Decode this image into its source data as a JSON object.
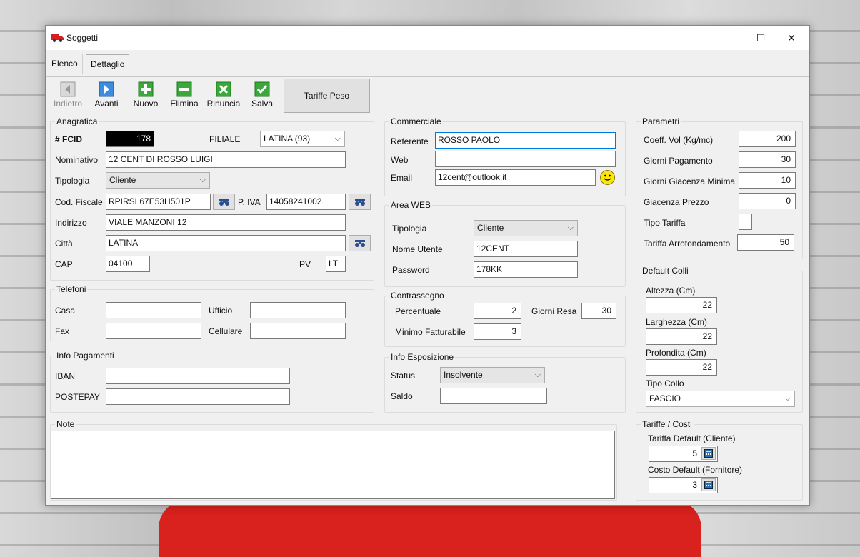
{
  "window": {
    "title": "Soggetti",
    "minimize": "—",
    "maximize": "☐",
    "close": "✕"
  },
  "tabs": [
    {
      "label": "Elenco",
      "active": false
    },
    {
      "label": "Dettaglio",
      "active": true
    }
  ],
  "toolbar": {
    "indietro": "Indietro",
    "avanti": "Avanti",
    "nuovo": "Nuovo",
    "elimina": "Elimina",
    "rinuncia": "Rinuncia",
    "salva": "Salva",
    "tariffe_peso": "Tariffe Peso"
  },
  "anagrafica": {
    "title": "Anagrafica",
    "fcid_label": "# FCID",
    "fcid_value": "178",
    "filiale_label": "FILIALE",
    "filiale_value": "LATINA (93)",
    "nominativo_label": "Nominativo",
    "nominativo_value": "12 CENT DI ROSSO LUIGI",
    "tipologia_label": "Tipologia",
    "tipologia_value": "Cliente",
    "codfiscale_label": "Cod. Fiscale",
    "codfiscale_value": "RPIRSL67E53H501P",
    "piva_label": "P. IVA",
    "piva_value": "14058241002",
    "indirizzo_label": "Indirizzo",
    "indirizzo_value": "VIALE MANZONI 12",
    "citta_label": "Città",
    "citta_value": "LATINA",
    "cap_label": "CAP",
    "cap_value": "04100",
    "pv_label": "PV",
    "pv_value": "LT"
  },
  "telefoni": {
    "title": "Telefoni",
    "casa_label": "Casa",
    "casa_value": "",
    "ufficio_label": "Ufficio",
    "ufficio_value": "",
    "fax_label": "Fax",
    "fax_value": "",
    "cellulare_label": "Cellulare",
    "cellulare_value": ""
  },
  "info_pagamenti": {
    "title": "Info Pagamenti",
    "iban_label": "IBAN",
    "iban_value": "",
    "postepay_label": "POSTEPAY",
    "postepay_value": ""
  },
  "note": {
    "title": "Note",
    "value": ""
  },
  "commerciale": {
    "title": "Commerciale",
    "referente_label": "Referente",
    "referente_value": "ROSSO PAOLO",
    "web_label": "Web",
    "web_value": "",
    "email_label": "Email",
    "email_value": "12cent@outlook.it"
  },
  "area_web": {
    "title": "Area WEB",
    "tipologia_label": "Tipologia",
    "tipologia_value": "Cliente",
    "nome_utente_label": "Nome Utente",
    "nome_utente_value": "12CENT",
    "password_label": "Password",
    "password_value": "178KK"
  },
  "contrassegno": {
    "title": "Contrassegno",
    "percentuale_label": "Percentuale",
    "percentuale_value": "2",
    "giorni_resa_label": "Giorni Resa",
    "giorni_resa_value": "30",
    "minimo_label": "Minimo Fatturabile",
    "minimo_value": "3"
  },
  "info_esposizione": {
    "title": "Info Esposizione",
    "status_label": "Status",
    "status_value": "Insolvente",
    "saldo_label": "Saldo",
    "saldo_value": ""
  },
  "parametri": {
    "title": "Parametri",
    "coeff_label": "Coeff. Vol (Kg/mc)",
    "coeff_value": "200",
    "giorni_pag_label": "Giorni Pagamento",
    "giorni_pag_value": "30",
    "giacenza_min_label": "Giorni Giacenza Minima",
    "giacenza_min_value": "10",
    "giacenza_prezzo_label": "Giacenza Prezzo",
    "giacenza_prezzo_value": "0",
    "tipo_tariffa_label": "Tipo Tariffa",
    "arrotondamento_label": "Tariffa Arrotondamento",
    "arrotondamento_value": "50"
  },
  "default_colli": {
    "title": "Default Colli",
    "altezza_label": "Altezza (Cm)",
    "altezza_value": "22",
    "larghezza_label": "Larghezza (Cm)",
    "larghezza_value": "22",
    "profondita_label": "Profondita (Cm)",
    "profondita_value": "22",
    "tipo_collo_label": "Tipo Collo",
    "tipo_collo_value": "FASCIO"
  },
  "tariffe_costi": {
    "title": "Tariffe / Costi",
    "tariffa_label": "Tariffa Default (Cliente)",
    "tariffa_value": "5",
    "costo_label": "Costo Default (Fornitore)",
    "costo_value": "3"
  }
}
